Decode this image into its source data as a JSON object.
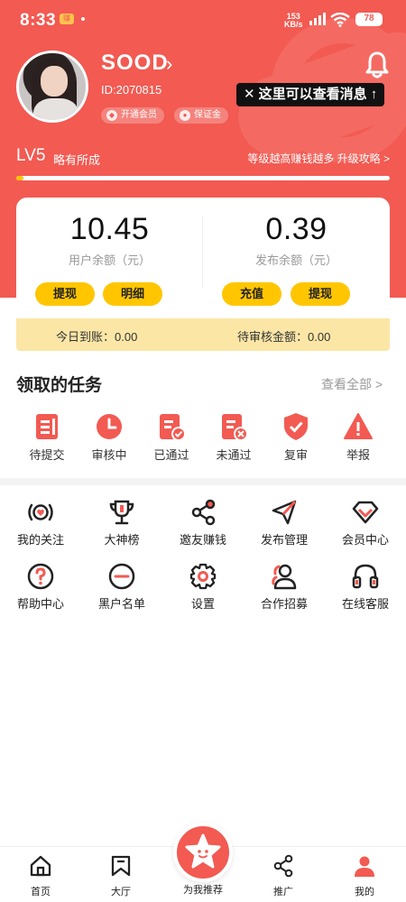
{
  "status_bar": {
    "time": "8:33",
    "app_badge": "赚",
    "net_speed_value": "153",
    "net_speed_unit": "KB/s",
    "battery": "78"
  },
  "profile": {
    "name": "SOOD",
    "id": "ID:2070815",
    "vip_label": "开通会员",
    "deposit_label": "保证金"
  },
  "tooltip": {
    "close": "✕",
    "text": "这里可以查看消息",
    "arrow": "↑"
  },
  "level": {
    "level": "LV5",
    "description": "略有所成",
    "hint": "等级越高赚钱越多 升级攻略 >",
    "progress_percent": 2
  },
  "balance": {
    "user_balance": "10.45",
    "user_balance_label": "用户余额（元）",
    "publish_balance": "0.39",
    "publish_balance_label": "发布余额（元）",
    "withdraw_label": "提现",
    "detail_label": "明细",
    "recharge_label": "充值",
    "withdraw2_label": "提现",
    "today_arrival": "今日到账：0.00",
    "pending_amount": "待审核金额：0.00"
  },
  "tasks": {
    "title": "领取的任务",
    "view_all": "查看全部 >",
    "items": [
      {
        "label": "待提交",
        "icon": "document-icon"
      },
      {
        "label": "审核中",
        "icon": "clock-icon"
      },
      {
        "label": "已通过",
        "icon": "document-check-icon"
      },
      {
        "label": "未通过",
        "icon": "document-x-icon"
      },
      {
        "label": "复审",
        "icon": "shield-check-icon"
      },
      {
        "label": "举报",
        "icon": "warning-icon"
      }
    ]
  },
  "tools": {
    "row1": [
      {
        "label": "我的关注",
        "icon": "heart-broadcast-icon"
      },
      {
        "label": "大神榜",
        "icon": "trophy-icon"
      },
      {
        "label": "邀友赚钱",
        "icon": "share-icon"
      },
      {
        "label": "发布管理",
        "icon": "send-icon"
      },
      {
        "label": "会员中心",
        "icon": "diamond-icon"
      }
    ],
    "row2": [
      {
        "label": "帮助中心",
        "icon": "help-icon"
      },
      {
        "label": "黑户名单",
        "icon": "minus-circle-icon"
      },
      {
        "label": "设置",
        "icon": "gear-icon"
      },
      {
        "label": "合作招募",
        "icon": "user-group-icon"
      },
      {
        "label": "在线客服",
        "icon": "headset-icon"
      }
    ]
  },
  "bottom_nav": {
    "home": "首页",
    "hall": "大厅",
    "recommend": "为我推荐",
    "promote": "推广",
    "mine": "我的"
  },
  "colors": {
    "brand_red": "#f25a52",
    "button_yellow": "#ffc600",
    "settle_bg": "#fbe6a6"
  }
}
